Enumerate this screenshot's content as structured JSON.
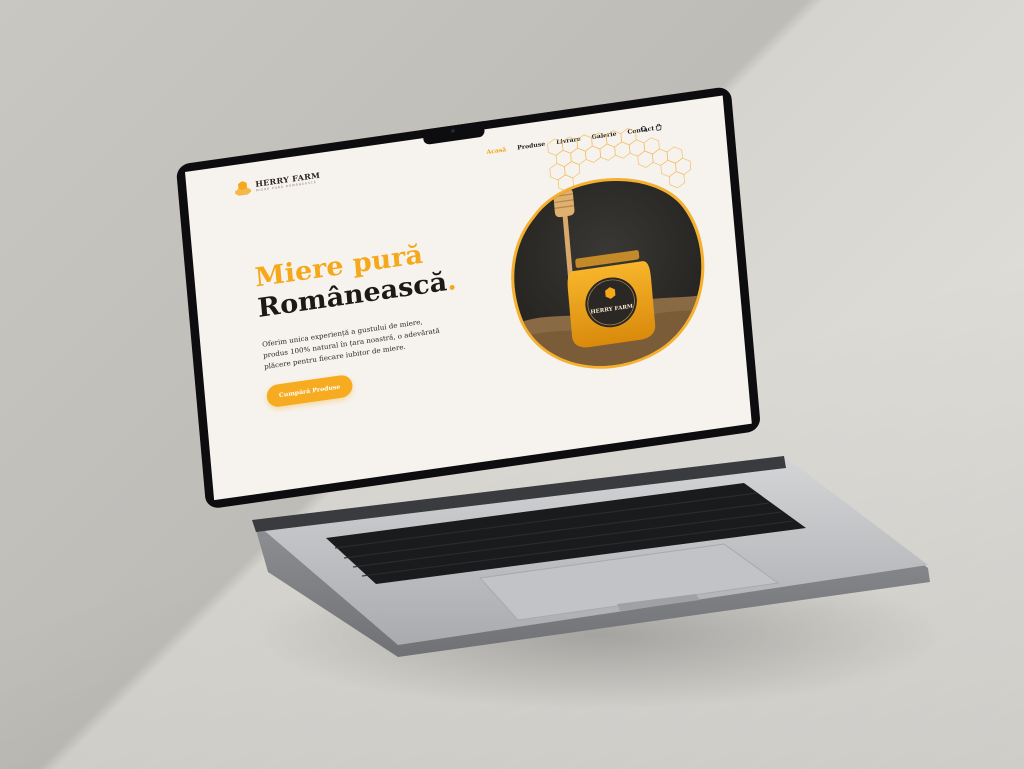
{
  "brand": {
    "name": "HERRY FARM",
    "tagline": "MIERE PURĂ ROMÂNEASCĂ"
  },
  "nav": {
    "items": [
      {
        "label": "Acasă",
        "active": true
      },
      {
        "label": "Produse",
        "active": false
      },
      {
        "label": "Livrare",
        "active": false
      },
      {
        "label": "Galerie",
        "active": false
      },
      {
        "label": "Contact",
        "active": false
      }
    ],
    "icons": [
      "search-icon",
      "cart-icon"
    ]
  },
  "hero": {
    "title_line1": "Miere pură",
    "title_line2": "Românească",
    "title_dot": ".",
    "description": "Oferim unica experiență a gustului de miere, produs 100% natural în țara noastră, o adevărată plăcere pentru fiecare iubitor de miere.",
    "cta_label": "Cumpără Produse"
  },
  "jar": {
    "label_name": "HERRY FARM"
  },
  "colors": {
    "accent": "#f5a81a",
    "dark": "#1c1a17",
    "page_bg": "#f6f3ee"
  }
}
